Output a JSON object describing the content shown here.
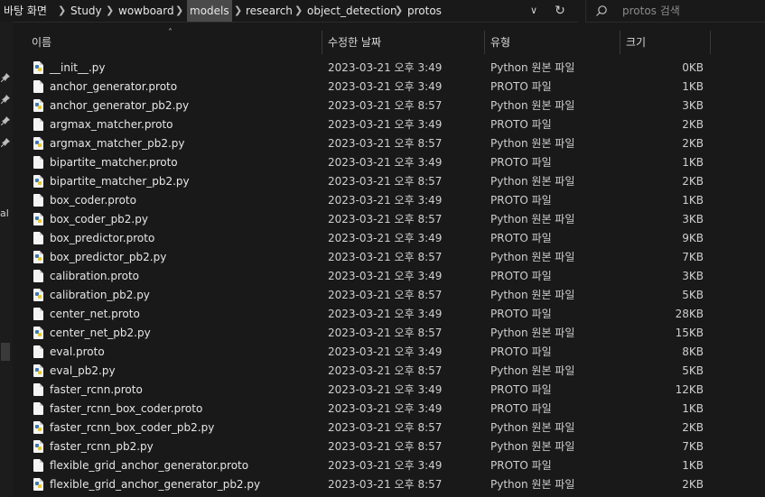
{
  "address_bar": {
    "breadcrumbs": [
      "바탕 화면",
      "Study",
      "wowboard",
      "models",
      "research",
      "object_detection",
      "protos"
    ],
    "highlighted": "models"
  },
  "search": {
    "placeholder": "protos 검색"
  },
  "nav_pane": {
    "text": "al"
  },
  "columns": {
    "name": "이름",
    "date": "수정한 날짜",
    "type": "유형",
    "size": "크기"
  },
  "files": [
    {
      "name": "__init__.py",
      "date": "2023-03-21 오후 3:49",
      "type": "Python 원본 파일",
      "size": "0KB",
      "icon": "python-file-icon"
    },
    {
      "name": "anchor_generator.proto",
      "date": "2023-03-21 오후 3:49",
      "type": "PROTO 파일",
      "size": "1KB",
      "icon": "proto-file-icon"
    },
    {
      "name": "anchor_generator_pb2.py",
      "date": "2023-03-21 오후 8:57",
      "type": "Python 원본 파일",
      "size": "3KB",
      "icon": "python-file-icon"
    },
    {
      "name": "argmax_matcher.proto",
      "date": "2023-03-21 오후 3:49",
      "type": "PROTO 파일",
      "size": "2KB",
      "icon": "proto-file-icon"
    },
    {
      "name": "argmax_matcher_pb2.py",
      "date": "2023-03-21 오후 8:57",
      "type": "Python 원본 파일",
      "size": "2KB",
      "icon": "python-file-icon"
    },
    {
      "name": "bipartite_matcher.proto",
      "date": "2023-03-21 오후 3:49",
      "type": "PROTO 파일",
      "size": "1KB",
      "icon": "proto-file-icon"
    },
    {
      "name": "bipartite_matcher_pb2.py",
      "date": "2023-03-21 오후 8:57",
      "type": "Python 원본 파일",
      "size": "2KB",
      "icon": "python-file-icon"
    },
    {
      "name": "box_coder.proto",
      "date": "2023-03-21 오후 3:49",
      "type": "PROTO 파일",
      "size": "1KB",
      "icon": "proto-file-icon"
    },
    {
      "name": "box_coder_pb2.py",
      "date": "2023-03-21 오후 8:57",
      "type": "Python 원본 파일",
      "size": "3KB",
      "icon": "python-file-icon"
    },
    {
      "name": "box_predictor.proto",
      "date": "2023-03-21 오후 3:49",
      "type": "PROTO 파일",
      "size": "9KB",
      "icon": "proto-file-icon"
    },
    {
      "name": "box_predictor_pb2.py",
      "date": "2023-03-21 오후 8:57",
      "type": "Python 원본 파일",
      "size": "7KB",
      "icon": "python-file-icon"
    },
    {
      "name": "calibration.proto",
      "date": "2023-03-21 오후 3:49",
      "type": "PROTO 파일",
      "size": "3KB",
      "icon": "proto-file-icon"
    },
    {
      "name": "calibration_pb2.py",
      "date": "2023-03-21 오후 8:57",
      "type": "Python 원본 파일",
      "size": "5KB",
      "icon": "python-file-icon"
    },
    {
      "name": "center_net.proto",
      "date": "2023-03-21 오후 3:49",
      "type": "PROTO 파일",
      "size": "28KB",
      "icon": "proto-file-icon"
    },
    {
      "name": "center_net_pb2.py",
      "date": "2023-03-21 오후 8:57",
      "type": "Python 원본 파일",
      "size": "15KB",
      "icon": "python-file-icon"
    },
    {
      "name": "eval.proto",
      "date": "2023-03-21 오후 3:49",
      "type": "PROTO 파일",
      "size": "8KB",
      "icon": "proto-file-icon"
    },
    {
      "name": "eval_pb2.py",
      "date": "2023-03-21 오후 8:57",
      "type": "Python 원본 파일",
      "size": "5KB",
      "icon": "python-file-icon"
    },
    {
      "name": "faster_rcnn.proto",
      "date": "2023-03-21 오후 3:49",
      "type": "PROTO 파일",
      "size": "12KB",
      "icon": "proto-file-icon"
    },
    {
      "name": "faster_rcnn_box_coder.proto",
      "date": "2023-03-21 오후 3:49",
      "type": "PROTO 파일",
      "size": "1KB",
      "icon": "proto-file-icon"
    },
    {
      "name": "faster_rcnn_box_coder_pb2.py",
      "date": "2023-03-21 오후 8:57",
      "type": "Python 원본 파일",
      "size": "2KB",
      "icon": "python-file-icon"
    },
    {
      "name": "faster_rcnn_pb2.py",
      "date": "2023-03-21 오후 8:57",
      "type": "Python 원본 파일",
      "size": "7KB",
      "icon": "python-file-icon"
    },
    {
      "name": "flexible_grid_anchor_generator.proto",
      "date": "2023-03-21 오후 3:49",
      "type": "PROTO 파일",
      "size": "1KB",
      "icon": "proto-file-icon"
    },
    {
      "name": "flexible_grid_anchor_generator_pb2.py",
      "date": "2023-03-21 오후 8:57",
      "type": "Python 원본 파일",
      "size": "2KB",
      "icon": "python-file-icon"
    }
  ]
}
